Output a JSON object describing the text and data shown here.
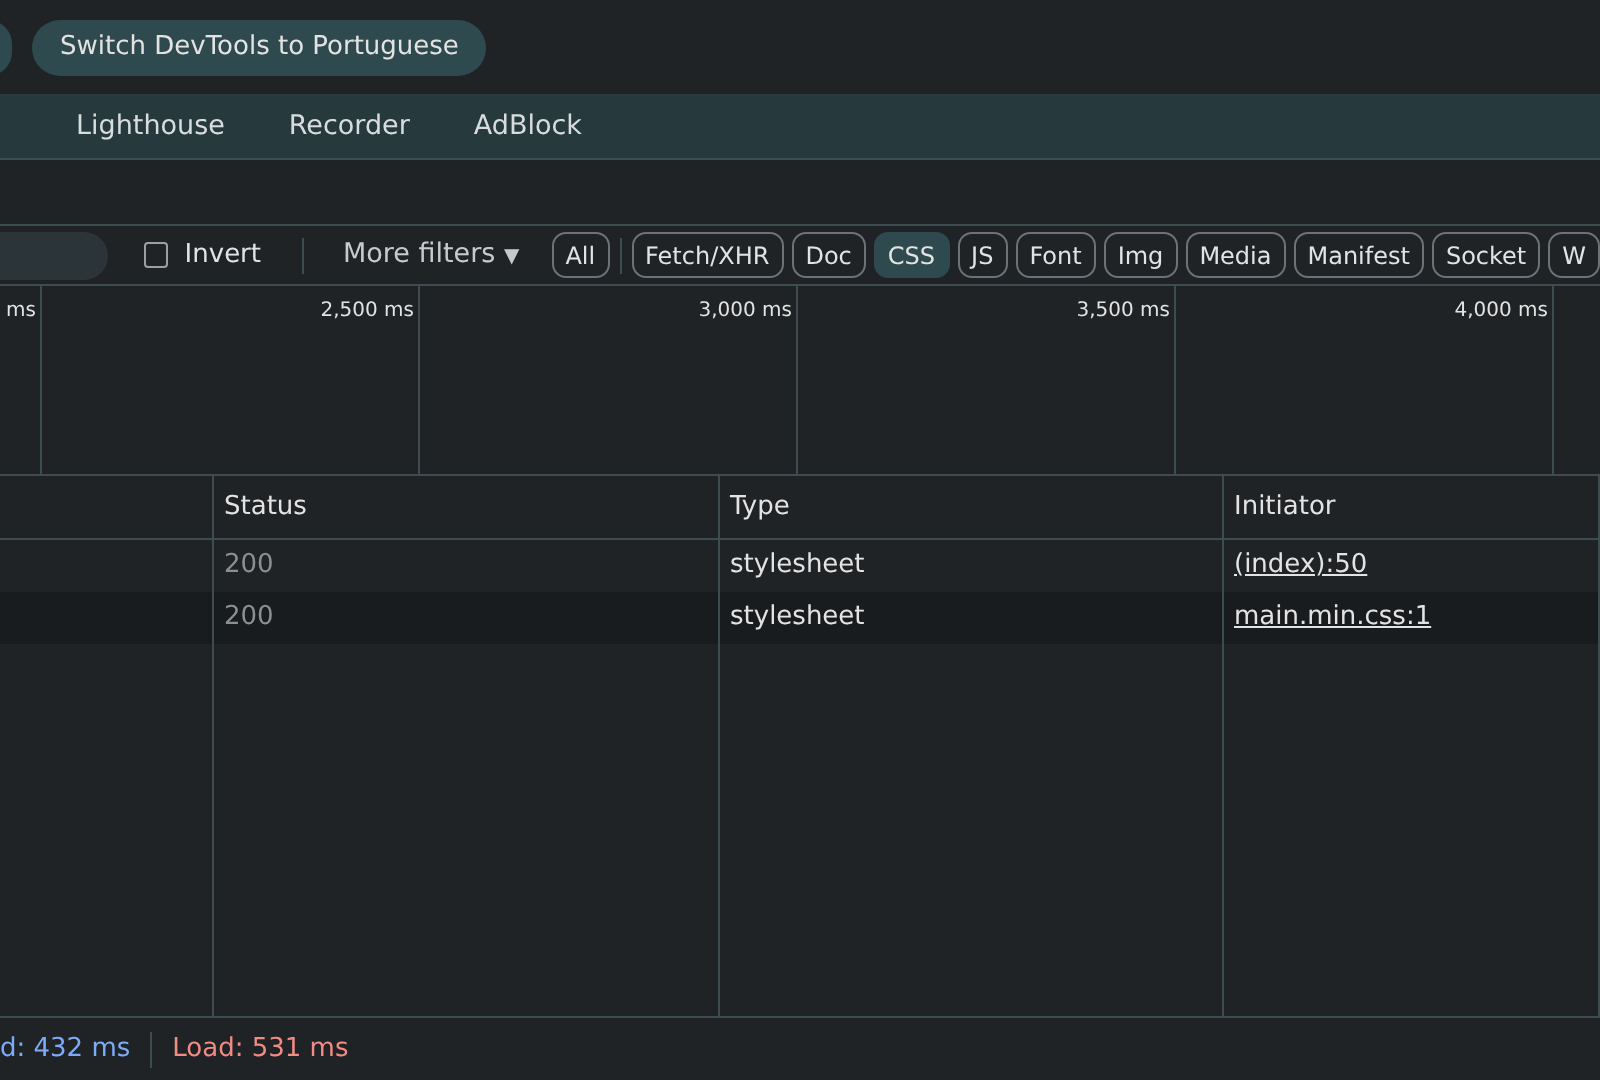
{
  "top_bar": {
    "buttons": [
      "Switch DevTools to Portuguese"
    ]
  },
  "tabs": [
    {
      "label": "Lighthouse",
      "selected": false
    },
    {
      "label": "Recorder",
      "selected": false
    },
    {
      "label": "AdBlock",
      "selected": false
    }
  ],
  "filter_bar": {
    "invert": {
      "label": "Invert",
      "checked": false
    },
    "more_filters": "More filters",
    "more_filters_caret": "▼",
    "types": [
      {
        "label": "All",
        "selected": false
      },
      {
        "label": "Fetch/XHR",
        "selected": false
      },
      {
        "label": "Doc",
        "selected": false
      },
      {
        "label": "CSS",
        "selected": true
      },
      {
        "label": "JS",
        "selected": false
      },
      {
        "label": "Font",
        "selected": false
      },
      {
        "label": "Img",
        "selected": false
      },
      {
        "label": "Media",
        "selected": false
      },
      {
        "label": "Manifest",
        "selected": false
      },
      {
        "label": "Socket",
        "selected": false
      },
      {
        "label": "W",
        "selected": false
      }
    ]
  },
  "timeline": {
    "ticks": [
      "ms",
      "2,500 ms",
      "3,000 ms",
      "3,500 ms",
      "4,000 ms"
    ]
  },
  "table": {
    "columns": [
      "Status",
      "Type",
      "Initiator"
    ],
    "rows": [
      {
        "status": "200",
        "type": "stylesheet",
        "initiator": "(index):50"
      },
      {
        "status": "200",
        "type": "stylesheet",
        "initiator": "main.min.css:1"
      }
    ]
  },
  "status_bar": {
    "dom_content_loaded": "d: 432 ms",
    "load": "Load: 531 ms"
  }
}
